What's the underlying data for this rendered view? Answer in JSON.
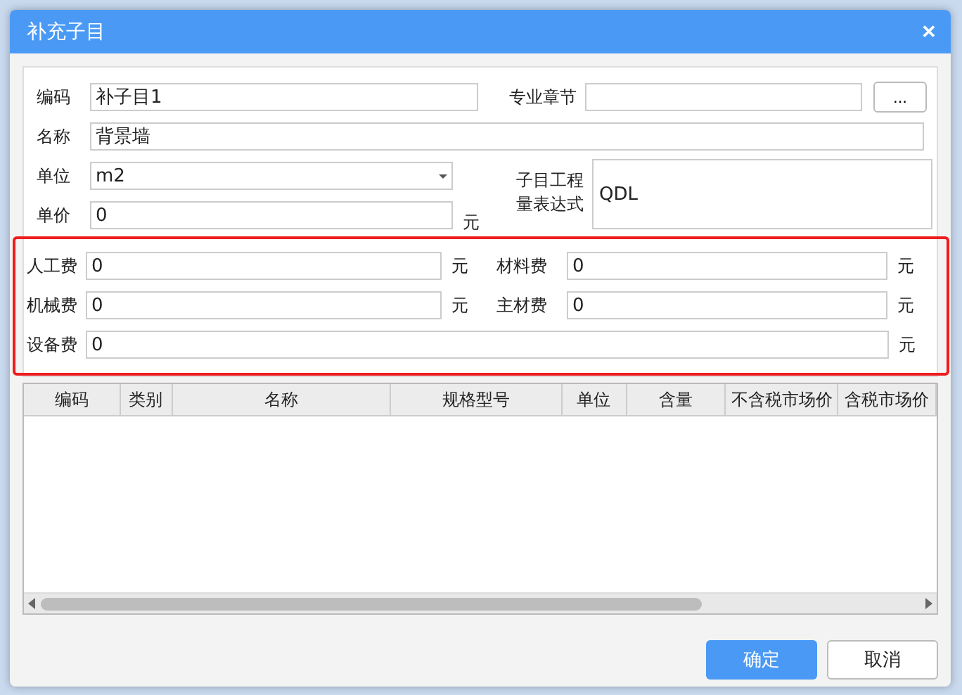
{
  "window": {
    "title": "补充子目",
    "close": "✕"
  },
  "form": {
    "code": {
      "label": "编码",
      "value": "补子目1"
    },
    "chapter": {
      "label": "专业章节",
      "browse": "..."
    },
    "name": {
      "label": "名称",
      "value": "背景墙"
    },
    "unit": {
      "label": "单位",
      "value": "m2"
    },
    "price": {
      "label": "单价",
      "value": "0",
      "suffix": "元"
    },
    "expression": {
      "label": "子目工程量表达式",
      "value": "QDL"
    }
  },
  "costs": [
    {
      "label": "人工费",
      "value": "0",
      "suffix": "元"
    },
    {
      "label": "材料费",
      "value": "0",
      "suffix": "元"
    },
    {
      "label": "机械费",
      "value": "0",
      "suffix": "元"
    },
    {
      "label": "主材费",
      "value": "0",
      "suffix": "元"
    },
    {
      "label": "设备费",
      "value": "0",
      "suffix": "元"
    }
  ],
  "table": {
    "columns": [
      "编码",
      "类别",
      "名称",
      "规格型号",
      "单位",
      "含量",
      "不含税市场价",
      "含税市场价"
    ]
  },
  "buttons": [
    {
      "label": "确定",
      "primary": true
    },
    {
      "label": "取消",
      "primary": false
    }
  ]
}
